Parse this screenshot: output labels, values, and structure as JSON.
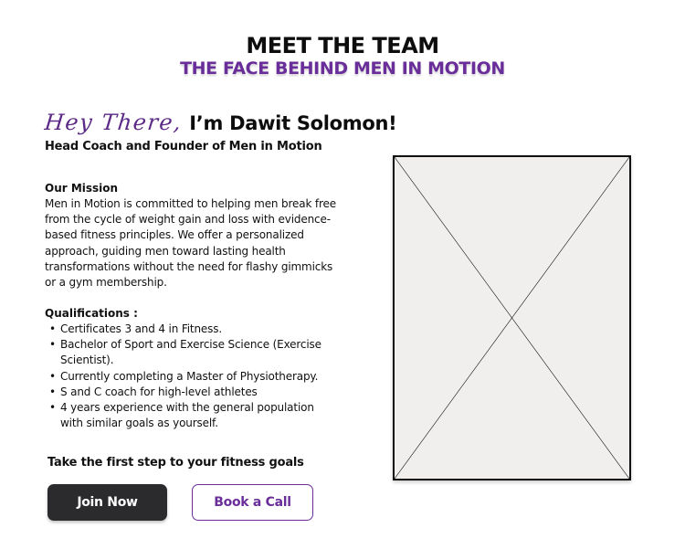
{
  "header": {
    "title": "MEET THE TEAM",
    "subtitle": "THE FACE BEHIND MEN IN MOTION"
  },
  "intro": {
    "greeting": "Hey There,",
    "name": "I’m Dawit Solomon!",
    "role": "Head Coach and Founder of Men in Motion"
  },
  "mission": {
    "heading": "Our Mission",
    "text": "Men in Motion is committed to helping men break free from the cycle of weight gain and loss with evidence-based fitness principles. We offer a personalized approach, guiding men toward lasting health transformations without the need for flashy gimmicks or a gym membership."
  },
  "qualifications": {
    "heading": "Qualifications :",
    "items": [
      "Certificates 3 and 4 in Fitness.",
      "Bachelor of Sport and Exercise Science (Exercise Scientist).",
      "Currently completing a Master of Physiotherapy.",
      "S and C coach for high-level athletes",
      "4 years experience with the general population with similar goals as yourself."
    ]
  },
  "cta": {
    "text": "Take the first step to your fitness goals",
    "join_label": "Join Now",
    "book_label": "Book a Call"
  },
  "photo": {
    "icon": "image-placeholder-icon"
  },
  "colors": {
    "brand_purple": "#6a2e9b",
    "dark_button": "#2b2b2e",
    "placeholder_bg": "#f0efee"
  }
}
